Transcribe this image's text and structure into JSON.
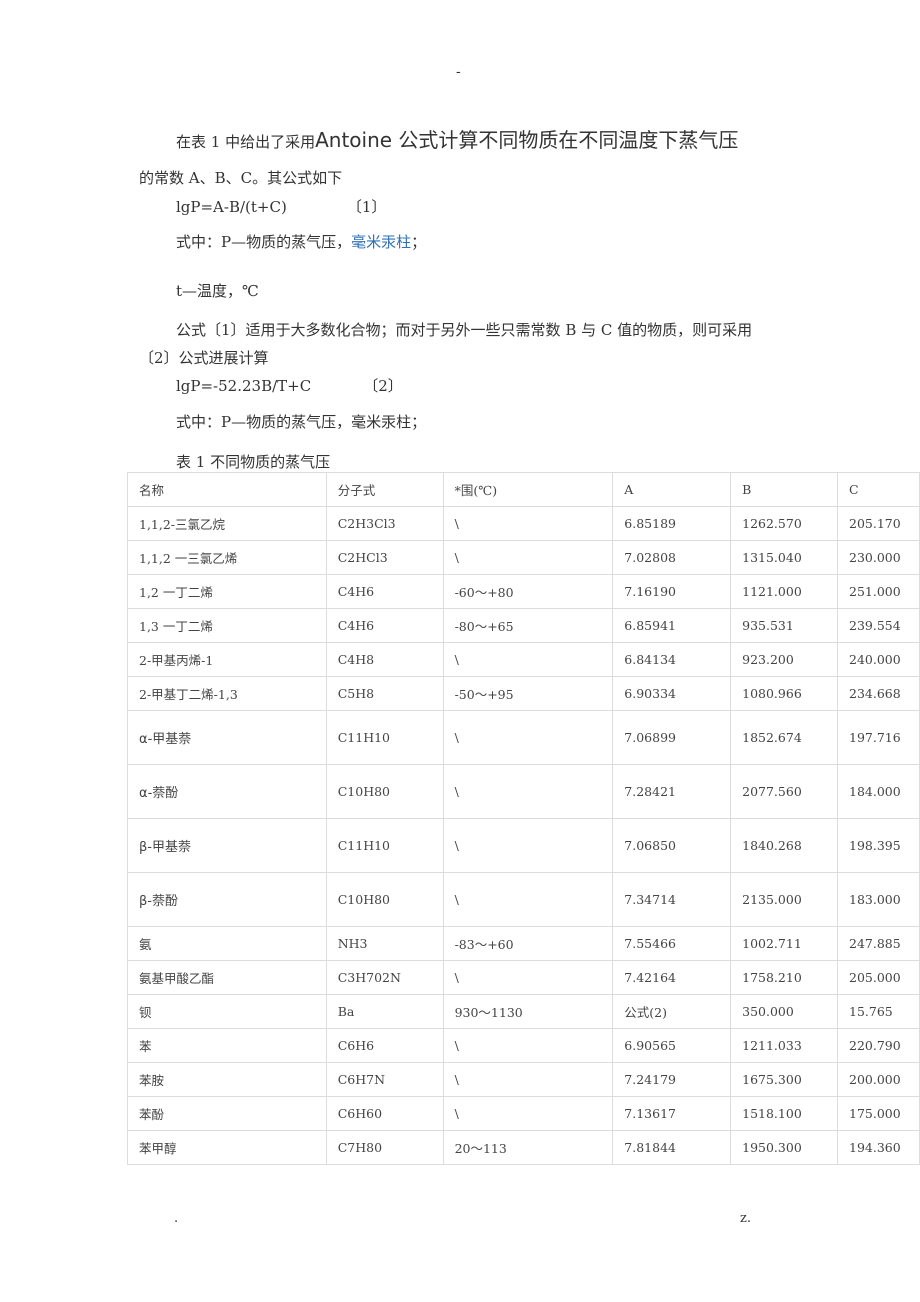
{
  "header": {
    "dot": "-"
  },
  "intro": {
    "line1_prefix": "在表 1 中给出了采用",
    "line1_big": "Antoine 公式计算不同物质在不同温度下蒸气压",
    "line2": "的常数 A、B、C。其公式如下"
  },
  "formula1": {
    "expr": "lgP=A-B/(t+C)",
    "num": "〔1〕"
  },
  "where1": {
    "prefix": "式中：P—物质的蒸气压，",
    "link": "毫米汞柱",
    "suffix": "；"
  },
  "where_t": "t—温度，℃",
  "para2": {
    "line1": "公式〔1〕适用于大多数化合物；而对于另外一些只需常数 B 与 C 值的物质，则可采用",
    "line2": "〔2〕公式进展计算"
  },
  "formula2": {
    "expr": "lgP=-52.23B/T+C",
    "num": "〔2〕"
  },
  "where2": "式中：P—物质的蒸气压，毫米汞柱；",
  "table_caption": "表 1  不同物质的蒸气压",
  "table": {
    "headers": [
      "名称",
      "分子式",
      "*围(℃)",
      "A",
      "B",
      "C"
    ],
    "rows": [
      [
        "1,1,2-三氯乙烷",
        "C2H3Cl3",
        "\\",
        "6.85189",
        "1262.570",
        "205.170"
      ],
      [
        "1,1,2 一三氯乙烯",
        "C2HCl3",
        "\\",
        "7.02808",
        "1315.040",
        "230.000"
      ],
      [
        "1,2 一丁二烯",
        "C4H6",
        "-60～+80",
        "7.16190",
        "1121.000",
        "251.000"
      ],
      [
        "1,3 一丁二烯",
        "C4H6",
        "-80～+65",
        "6.85941",
        "935.531",
        "239.554"
      ],
      [
        "2-甲基丙烯-1",
        "C4H8",
        "\\",
        "6.84134",
        "923.200",
        "240.000"
      ],
      [
        "2-甲基丁二烯-1,3",
        "C5H8",
        "-50～+95",
        "6.90334",
        "1080.966",
        "234.668"
      ],
      [
        "α-甲基萘",
        "C11H10",
        "\\",
        "7.06899",
        "1852.674",
        "197.716"
      ],
      [
        "α-萘酚",
        "C10H80",
        "\\",
        "7.28421",
        "2077.560",
        "184.000"
      ],
      [
        "β-甲基萘",
        "C11H10",
        "\\",
        "7.06850",
        "1840.268",
        "198.395"
      ],
      [
        "β-萘酚",
        "C10H80",
        "\\",
        "7.34714",
        "2135.000",
        "183.000"
      ],
      [
        "氨",
        "NH3",
        "-83～+60",
        "7.55466",
        "1002.711",
        "247.885"
      ],
      [
        "氨基甲酸乙酯",
        "C3H702N",
        "\\",
        "7.42164",
        "1758.210",
        "205.000"
      ],
      [
        "钡",
        "Ba",
        "930～1130",
        "公式(2)",
        "350.000",
        "15.765"
      ],
      [
        "苯",
        "C6H6",
        "\\",
        "6.90565",
        "1211.033",
        "220.790"
      ],
      [
        "苯胺",
        "C6H7N",
        "\\",
        "7.24179",
        "1675.300",
        "200.000"
      ],
      [
        "苯酚",
        "C6H60",
        "\\",
        "7.13617",
        "1518.100",
        "175.000"
      ],
      [
        "苯甲醇",
        "C7H80",
        "20～113",
        "7.81844",
        "1950.300",
        "194.360"
      ]
    ]
  },
  "footer": {
    "left": ".",
    "right": "z."
  }
}
